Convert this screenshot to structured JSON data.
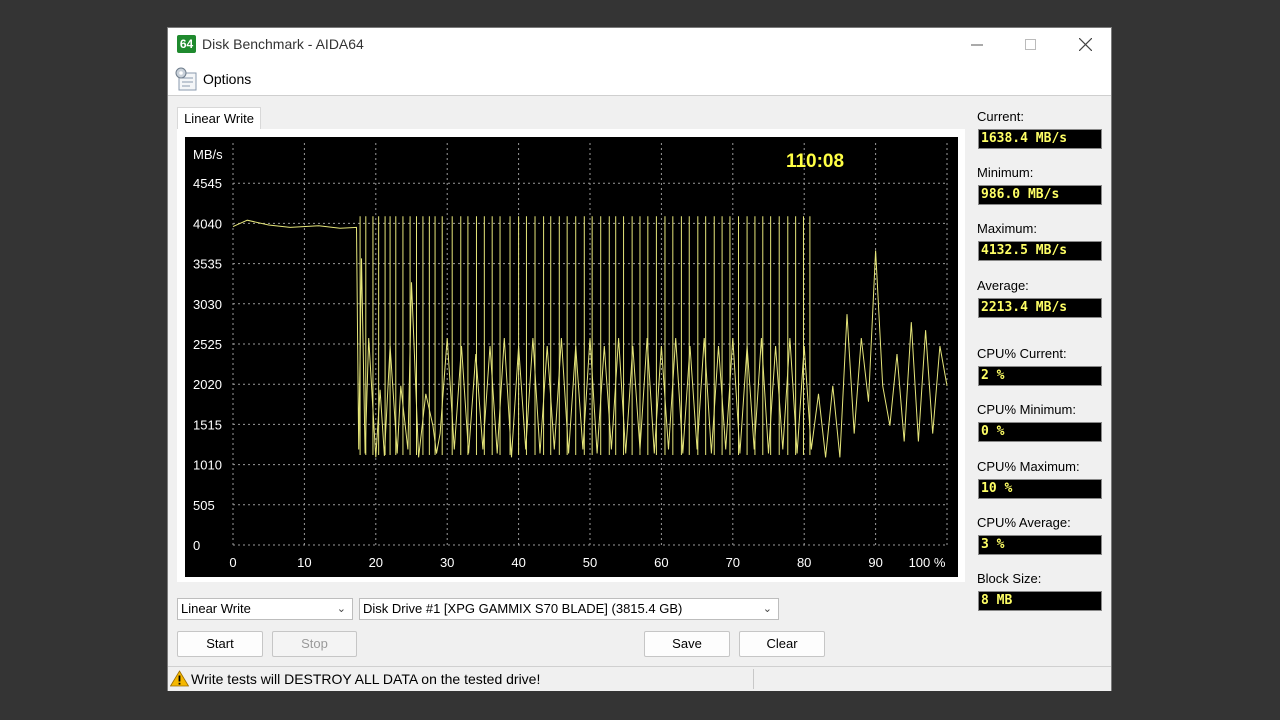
{
  "window": {
    "app_icon_text": "64",
    "title": "Disk Benchmark - AIDA64"
  },
  "menu": {
    "options_label": "Options"
  },
  "tab": {
    "label": "Linear Write"
  },
  "chart_data": {
    "type": "line",
    "ylabel": "MB/s",
    "timer": "110:08",
    "yticks": [
      "4545",
      "4040",
      "3535",
      "3030",
      "2525",
      "2020",
      "1515",
      "1010",
      "505",
      "0"
    ],
    "ytick_values": [
      4545,
      4040,
      3535,
      3030,
      2525,
      2020,
      1515,
      1010,
      505,
      0
    ],
    "xticks": [
      "0",
      "10",
      "20",
      "30",
      "40",
      "50",
      "60",
      "70",
      "80",
      "90",
      "100 %"
    ],
    "xtick_values": [
      0,
      10,
      20,
      30,
      40,
      50,
      60,
      70,
      80,
      90,
      100
    ],
    "ylim": [
      0,
      5050
    ],
    "xlim": [
      0,
      100
    ],
    "grid": true,
    "line_color": "#e6e67a",
    "series": [
      {
        "points": [
          [
            0,
            4000
          ],
          [
            2,
            4080
          ],
          [
            5,
            4020
          ],
          [
            8,
            3990
          ],
          [
            12,
            4010
          ],
          [
            15,
            3980
          ],
          [
            17.3,
            3990
          ],
          [
            17.6,
            1200
          ],
          [
            18,
            3600
          ],
          [
            18.5,
            1150
          ],
          [
            19,
            2600
          ],
          [
            20,
            1100
          ],
          [
            20.6,
            1950
          ],
          [
            21.2,
            1120
          ],
          [
            22,
            2500
          ],
          [
            23,
            1150
          ],
          [
            23.5,
            2000
          ],
          [
            24.5,
            1200
          ],
          [
            25,
            3300
          ],
          [
            26,
            1100
          ],
          [
            27,
            1900
          ],
          [
            28,
            1500
          ],
          [
            28.5,
            1150
          ],
          [
            29,
            1400
          ],
          [
            30,
            2600
          ],
          [
            31,
            1200
          ],
          [
            32,
            2500
          ],
          [
            33,
            1150
          ],
          [
            34,
            2400
          ],
          [
            35,
            1200
          ],
          [
            36,
            2500
          ],
          [
            37,
            1150
          ],
          [
            38,
            2600
          ],
          [
            39,
            1100
          ],
          [
            40,
            2500
          ],
          [
            41,
            1200
          ],
          [
            42,
            2600
          ],
          [
            43,
            1150
          ],
          [
            44,
            2500
          ],
          [
            45,
            1200
          ],
          [
            46,
            2600
          ],
          [
            47,
            1150
          ],
          [
            48,
            2500
          ],
          [
            49,
            1200
          ],
          [
            50,
            2600
          ],
          [
            51,
            1150
          ],
          [
            52,
            2500
          ],
          [
            53,
            1200
          ],
          [
            54,
            2600
          ],
          [
            55,
            1150
          ],
          [
            56,
            2500
          ],
          [
            57,
            1200
          ],
          [
            58,
            2600
          ],
          [
            59,
            1150
          ],
          [
            60,
            2500
          ],
          [
            61,
            1200
          ],
          [
            62,
            2600
          ],
          [
            63,
            1150
          ],
          [
            64,
            2500
          ],
          [
            65,
            1200
          ],
          [
            66,
            2600
          ],
          [
            67,
            1150
          ],
          [
            68,
            2500
          ],
          [
            69,
            1200
          ],
          [
            70,
            2600
          ],
          [
            71,
            1150
          ],
          [
            72,
            2500
          ],
          [
            73,
            1200
          ],
          [
            74,
            2600
          ],
          [
            75,
            1150
          ],
          [
            76,
            2500
          ],
          [
            77,
            1200
          ],
          [
            78,
            2600
          ],
          [
            79,
            1150
          ],
          [
            80,
            2500
          ],
          [
            81,
            1200
          ],
          [
            82,
            1900
          ],
          [
            83,
            1100
          ],
          [
            84,
            2000
          ],
          [
            85,
            1100
          ],
          [
            86,
            2900
          ],
          [
            87,
            1400
          ],
          [
            88,
            2600
          ],
          [
            89,
            1800
          ],
          [
            90,
            3700
          ],
          [
            91,
            2000
          ],
          [
            92,
            1500
          ],
          [
            93,
            2400
          ],
          [
            94,
            1300
          ],
          [
            95,
            2800
          ],
          [
            96,
            1300
          ],
          [
            97,
            2700
          ],
          [
            98,
            1400
          ],
          [
            99,
            2500
          ],
          [
            100,
            2000
          ]
        ]
      }
    ],
    "spikes": [
      17.8,
      18.6,
      19.6,
      20.4,
      21.3,
      22.0,
      22.8,
      23.8,
      24.8,
      25.7,
      26.6,
      27.5,
      28.3,
      29.3,
      30.7,
      31.9,
      32.9,
      34.1,
      35.2,
      36.3,
      37.4,
      38.8,
      40.0,
      41.1,
      42.3,
      43.5,
      44.5,
      45.7,
      46.8,
      48.0,
      49.2,
      50.3,
      51.5,
      52.7,
      53.6,
      54.7,
      55.9,
      57.0,
      58.1,
      59.3,
      60.5,
      61.6,
      62.8,
      63.9,
      65.1,
      66.2,
      67.4,
      68.5,
      69.6,
      70.8,
      72.0,
      73.1,
      74.2,
      75.3,
      76.5,
      77.7,
      78.8,
      79.9,
      80.8
    ],
    "spike_top": 4130,
    "spike_bottom": 1130
  },
  "stats": {
    "current_label": "Current:",
    "current_value": "1638.4 MB/s",
    "minimum_label": "Minimum:",
    "minimum_value": "986.0 MB/s",
    "maximum_label": "Maximum:",
    "maximum_value": "4132.5 MB/s",
    "average_label": "Average:",
    "average_value": "2213.4 MB/s",
    "cpu_current_label": "CPU% Current:",
    "cpu_current_value": "2 %",
    "cpu_minimum_label": "CPU% Minimum:",
    "cpu_minimum_value": "0 %",
    "cpu_maximum_label": "CPU% Maximum:",
    "cpu_maximum_value": "10 %",
    "cpu_average_label": "CPU% Average:",
    "cpu_average_value": "3 %",
    "block_size_label": "Block Size:",
    "block_size_value": "8 MB"
  },
  "controls": {
    "test_select": "Linear Write",
    "drive_select": "Disk Drive #1  [XPG GAMMIX S70 BLADE]  (3815.4 GB)",
    "start_label": "Start",
    "stop_label": "Stop",
    "save_label": "Save",
    "clear_label": "Clear"
  },
  "status": {
    "warning_text": "Write tests will DESTROY ALL DATA on the tested drive!"
  }
}
